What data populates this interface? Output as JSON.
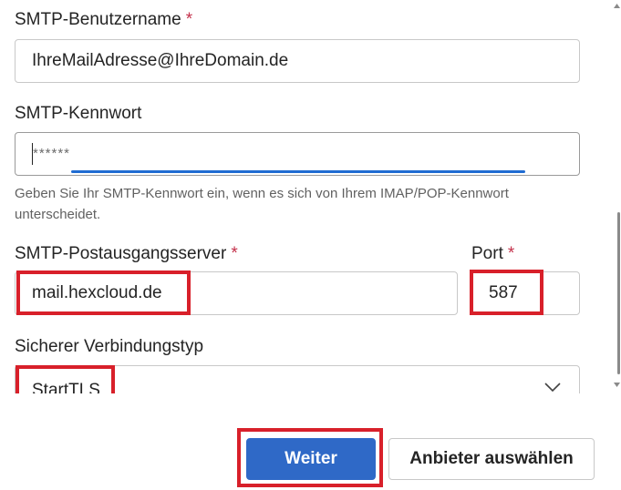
{
  "form": {
    "username": {
      "label": "SMTP-Benutzername",
      "required_mark": "*",
      "value": "IhreMailAdresse@IhreDomain.de"
    },
    "password": {
      "label": "SMTP-Kennwort",
      "value": "******",
      "hint": "Geben Sie Ihr SMTP-Kennwort ein, wenn es sich von Ihrem IMAP/POP-Kennwort unterscheidet."
    },
    "server": {
      "label": "SMTP-Postausgangsserver",
      "required_mark": "*",
      "value": "mail.hexcloud.de"
    },
    "port": {
      "label": "Port",
      "required_mark": "*",
      "value": "587"
    },
    "connection_type": {
      "label": "Sicherer Verbindungstyp",
      "selected": "StartTLS"
    }
  },
  "buttons": {
    "next": "Weiter",
    "choose_provider": "Anbieter auswählen"
  },
  "colors": {
    "highlight": "#d8202a",
    "primary": "#2f69c7",
    "required": "#c4314b",
    "focus": "#1f6cd2"
  }
}
